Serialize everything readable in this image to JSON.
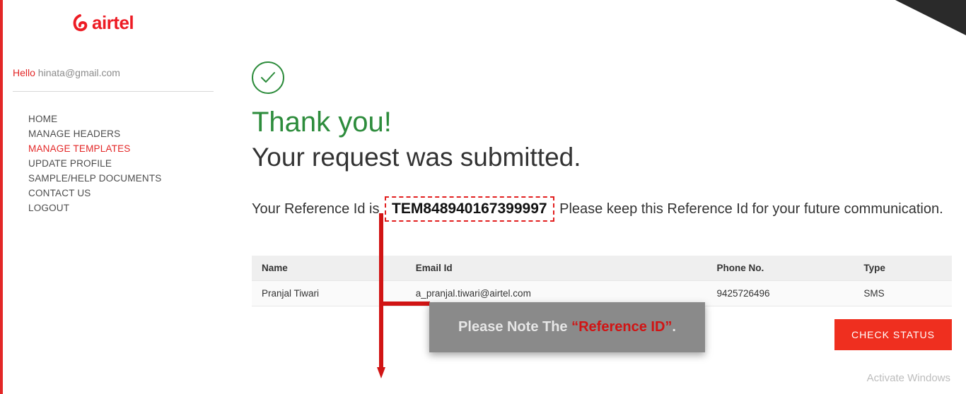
{
  "brand": {
    "name": "airtel"
  },
  "user": {
    "greeting_prefix": "Hello",
    "email": "hinata@gmail.com"
  },
  "sidebar": {
    "items": [
      {
        "label": "HOME",
        "active": false
      },
      {
        "label": "MANAGE HEADERS",
        "active": false
      },
      {
        "label": "MANAGE TEMPLATES",
        "active": true
      },
      {
        "label": "UPDATE PROFILE",
        "active": false
      },
      {
        "label": "SAMPLE/HELP DOCUMENTS",
        "active": false
      },
      {
        "label": "CONTACT US",
        "active": false
      },
      {
        "label": "LOGOUT",
        "active": false
      }
    ]
  },
  "main": {
    "thank_you": "Thank you!",
    "subhead": "Your request was submitted.",
    "ref_prefix": "Your Reference Id is",
    "ref_id": "TEM848940167399997",
    "ref_suffix": " Please keep this Reference Id for your future communication.",
    "table": {
      "headers": {
        "name": "Name",
        "email": "Email Id",
        "phone": "Phone No.",
        "type": "Type"
      },
      "row": {
        "name": "Pranjal Tiwari",
        "email": "a_pranjal.tiwari@airtel.com",
        "phone": "9425726496",
        "type": "SMS"
      }
    },
    "check_status": "CHECK STATUS"
  },
  "annotation": {
    "note_prefix": "Please Note The ",
    "note_highlight": "“Reference ID”",
    "note_suffix": "."
  },
  "watermark": "Activate Windows"
}
